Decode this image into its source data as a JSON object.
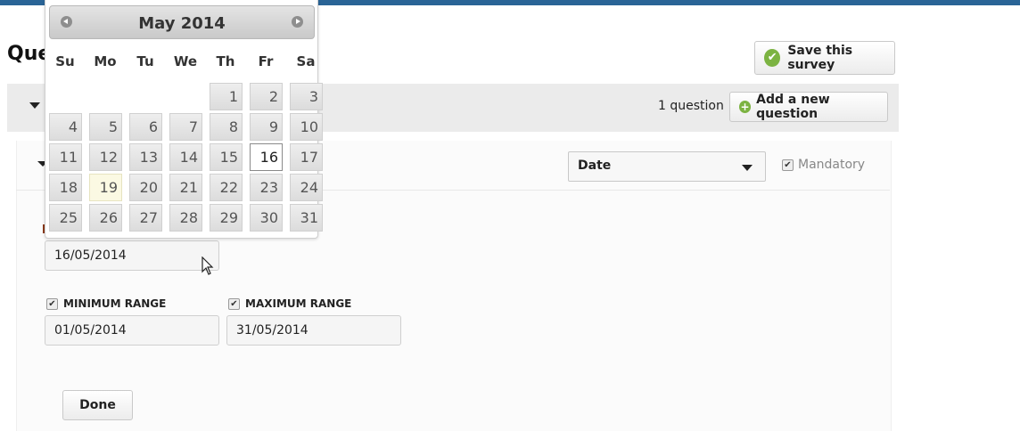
{
  "page": {
    "title": "Que"
  },
  "toolbar": {
    "save_label": "Save this survey"
  },
  "section": {
    "question_count": "1 question",
    "add_label": "Add a new question"
  },
  "question": {
    "type_value": "Date",
    "mandatory_label": "Mandatory",
    "default_value": "16/05/2014",
    "min_label": "MINIMUM RANGE",
    "min_value": "01/05/2014",
    "max_label": "MAXIMUM RANGE",
    "max_value": "31/05/2014",
    "done_label": "Done"
  },
  "datepicker": {
    "title": "May 2014",
    "weekdays": [
      "Su",
      "Mo",
      "Tu",
      "We",
      "Th",
      "Fr",
      "Sa"
    ],
    "days": [
      "1",
      "2",
      "3",
      "4",
      "5",
      "6",
      "7",
      "8",
      "9",
      "10",
      "11",
      "12",
      "13",
      "14",
      "15",
      "16",
      "17",
      "18",
      "19",
      "20",
      "21",
      "22",
      "23",
      "24",
      "25",
      "26",
      "27",
      "28",
      "29",
      "30",
      "31"
    ],
    "first_weekday_index": 4,
    "selected_day": 16,
    "today_day": 19
  },
  "colors": {
    "accent_bar": "#2a6496",
    "icon_green": "#7cb342"
  }
}
